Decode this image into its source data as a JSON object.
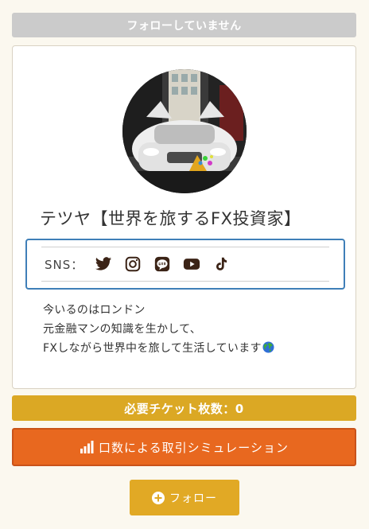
{
  "follow_status": {
    "label": "フォローしていません"
  },
  "profile": {
    "name": "テツヤ【世界を旅するFX投資家】",
    "avatar_icon": "car-photo-avatar"
  },
  "sns": {
    "label": "SNS：",
    "icons": [
      "twitter-icon",
      "instagram-icon",
      "line-icon",
      "youtube-icon",
      "tiktok-icon"
    ]
  },
  "bio": {
    "lines": [
      "今いるのはロンドン",
      "元金融マンの知識を生かして、",
      "FXしながら世界中を旅して生活しています"
    ],
    "emoji_icon": "earth-globe-icon"
  },
  "ticket": {
    "label": "必要チケット枚数：0"
  },
  "simulation_button": {
    "label": "口数による取引シミュレーション",
    "icon": "bar-chart-icon"
  },
  "follow_button": {
    "label": "フォロー",
    "icon": "plus-circle-icon"
  },
  "colors": {
    "background": "#fbf8ef",
    "status_gray": "#cbcbcb",
    "sns_border": "#3f7fb8",
    "ticket_gold": "#dba824",
    "simulation_orange": "#e8681f",
    "follow_gold": "#e1a925",
    "icon_dark": "#3b2316"
  }
}
